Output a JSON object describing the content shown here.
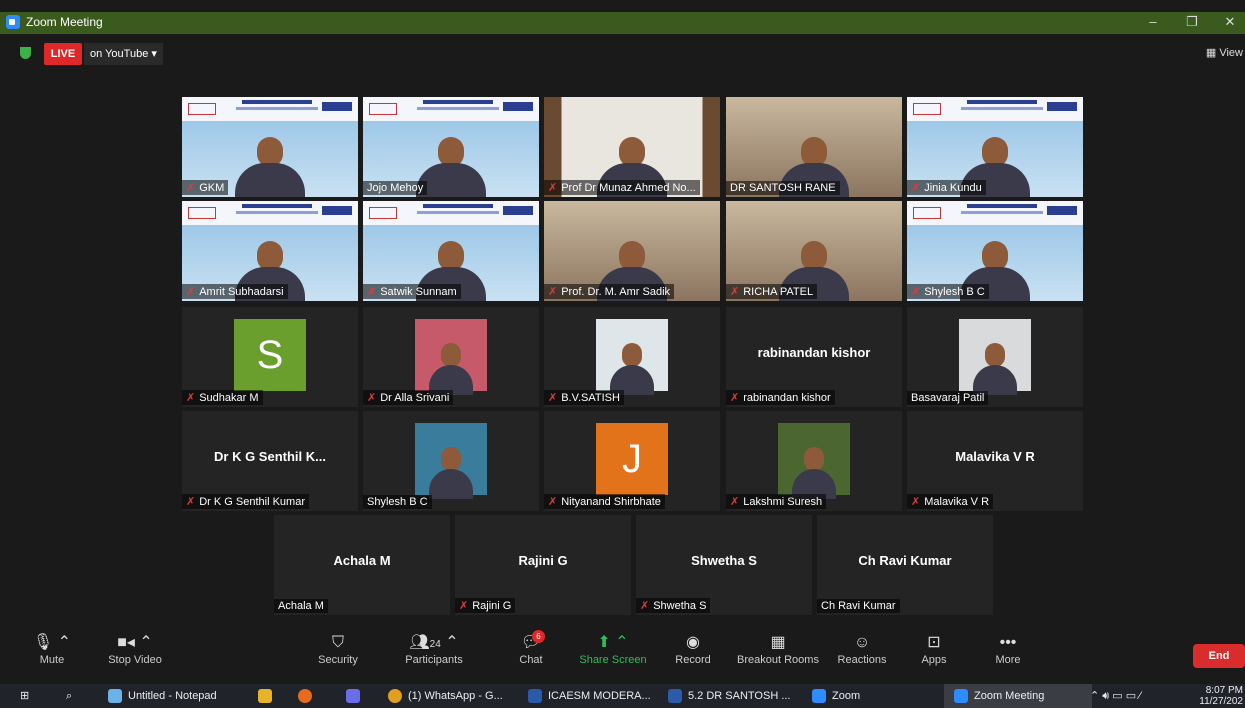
{
  "window": {
    "title": "Zoom Meeting",
    "minimize": "–",
    "restore": "❐",
    "close": "✕"
  },
  "topbar": {
    "live": "LIVE",
    "stream": "on YouTube ▾",
    "view": "View"
  },
  "tiles": [
    {
      "name": "GKM",
      "muted": true,
      "type": "video"
    },
    {
      "name": "Jojo Mehoy",
      "muted": false,
      "type": "video",
      "active": true
    },
    {
      "name": "Prof Dr Munaz Ahmed No...",
      "muted": true,
      "type": "video"
    },
    {
      "name": "DR SANTOSH RANE",
      "muted": false,
      "type": "video"
    },
    {
      "name": "Jinia Kundu",
      "muted": true,
      "type": "video"
    },
    {
      "name": "Amrit Subhadarsi",
      "muted": true,
      "type": "video"
    },
    {
      "name": "Satwik Sunnam",
      "muted": true,
      "type": "video"
    },
    {
      "name": "Prof. Dr. M. Amr Sadik",
      "muted": true,
      "type": "video"
    },
    {
      "name": "RICHA PATEL",
      "muted": true,
      "type": "video"
    },
    {
      "name": "Shylesh B C",
      "muted": true,
      "type": "video"
    },
    {
      "name": "Sudhakar M",
      "muted": true,
      "type": "letter",
      "letter": "S",
      "color": "#6a9e2d"
    },
    {
      "name": "Dr Alla Srivani",
      "muted": true,
      "type": "photo",
      "color": "#c65a6a"
    },
    {
      "name": "B.V.SATISH",
      "muted": true,
      "type": "photo",
      "color": "#dfe6ea"
    },
    {
      "name": "rabinandan kishor",
      "muted": true,
      "type": "text",
      "big": "rabinandan kishor"
    },
    {
      "name": "Basavaraj Patil",
      "muted": false,
      "type": "photo",
      "color": "#d8dadc"
    },
    {
      "name": "Dr K G Senthil Kumar",
      "muted": true,
      "type": "text",
      "big": "Dr K G Senthil K..."
    },
    {
      "name": "Shylesh B C",
      "muted": false,
      "type": "photo",
      "color": "#3a7c9c"
    },
    {
      "name": "Nityanand Shirbhate",
      "muted": true,
      "type": "letter",
      "letter": "J",
      "color": "#e2731b"
    },
    {
      "name": "Lakshmi Suresh",
      "muted": true,
      "type": "photo",
      "color": "#4b6630"
    },
    {
      "name": "Malavika V R",
      "muted": true,
      "type": "text",
      "big": "Malavika V R"
    },
    {
      "name": "Achala M",
      "muted": false,
      "type": "text",
      "big": "Achala M"
    },
    {
      "name": "Rajini G",
      "muted": true,
      "type": "text",
      "big": "Rajini G"
    },
    {
      "name": "Shwetha S",
      "muted": true,
      "type": "text",
      "big": "Shwetha S"
    },
    {
      "name": "Ch Ravi Kumar",
      "muted": false,
      "type": "text",
      "big": "Ch Ravi Kumar"
    }
  ],
  "toolbar": {
    "mute": "Mute",
    "stop_video": "Stop Video",
    "security": "Security",
    "participants": "Participants",
    "participants_count": "24",
    "chat": "Chat",
    "chat_badge": "6",
    "share_screen": "Share Screen",
    "record": "Record",
    "breakout": "Breakout Rooms",
    "reactions": "Reactions",
    "apps": "Apps",
    "more": "More",
    "end": "End"
  },
  "taskbar": {
    "items": [
      "Untitled - Notepad",
      "(1) WhatsApp - G...",
      "ICAESM MODERA...",
      "5.2 DR SANTOSH ...",
      "Zoom",
      "Zoom Meeting"
    ],
    "time": "8:07 PM",
    "date": "11/27/202"
  }
}
